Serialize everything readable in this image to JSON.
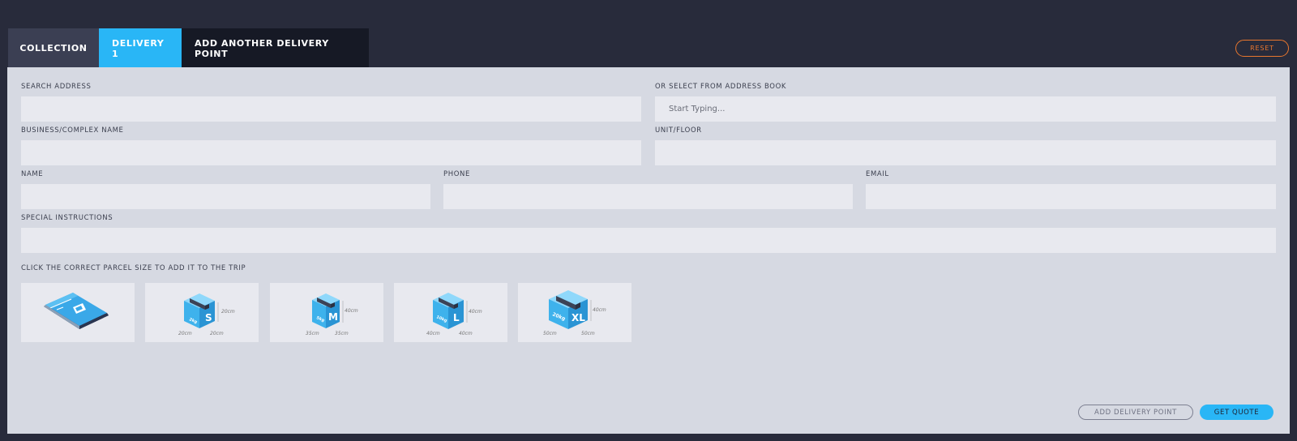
{
  "tabs": {
    "collection": "COLLECTION",
    "delivery": "DELIVERY 1",
    "add_delivery_point": "ADD ANOTHER DELIVERY POINT"
  },
  "reset_label": "RESET",
  "form": {
    "search_address_label": "SEARCH ADDRESS",
    "search_address_value": "",
    "address_book_label": "OR SELECT FROM ADDRESS BOOK",
    "address_book_placeholder": "Start Typing...",
    "business_label": "BUSINESS/COMPLEX NAME",
    "business_value": "",
    "unit_label": "UNIT/FLOOR",
    "unit_value": "",
    "name_label": "NAME",
    "name_value": "",
    "phone_label": "PHONE",
    "phone_value": "",
    "email_label": "EMAIL",
    "email_value": "",
    "instructions_label": "SPECIAL INSTRUCTIONS",
    "instructions_value": ""
  },
  "parcels": {
    "label": "CLICK THE CORRECT PARCEL SIZE TO ADD IT TO THE TRIP",
    "items": [
      {
        "size": "",
        "weight": "",
        "dims": [
          "",
          "",
          ""
        ],
        "icon": "envelope-icon"
      },
      {
        "size": "S",
        "weight": "2kg",
        "dims": [
          "20cm",
          "20cm",
          "20cm"
        ],
        "icon": "box-small-icon"
      },
      {
        "size": "M",
        "weight": "5kg",
        "dims": [
          "40cm",
          "35cm",
          "35cm"
        ],
        "icon": "box-medium-icon"
      },
      {
        "size": "L",
        "weight": "10kg",
        "dims": [
          "40cm",
          "40cm",
          "40cm"
        ],
        "icon": "box-large-icon"
      },
      {
        "size": "XL",
        "weight": "20kg",
        "dims": [
          "40cm",
          "50cm",
          "50cm"
        ],
        "icon": "box-xl-icon"
      }
    ]
  },
  "actions": {
    "add_delivery_point": "ADD DELIVERY POINT",
    "get_quote": "GET QUOTE"
  },
  "colors": {
    "accent": "#29b6f6",
    "reset": "#e8762e",
    "background": "#282b3b",
    "panel": "#d6d9e2"
  }
}
